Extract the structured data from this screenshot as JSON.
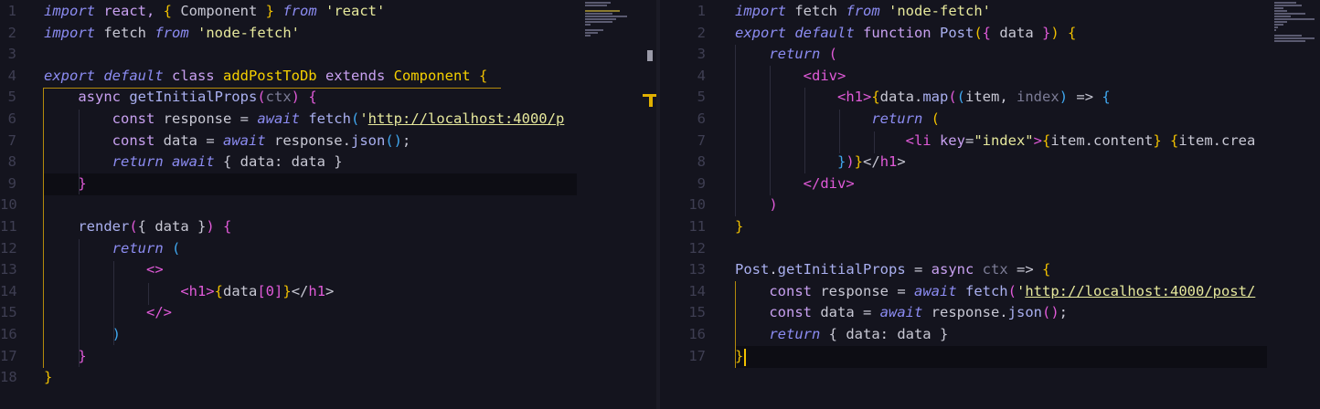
{
  "left_editor": {
    "lines": [
      {
        "n": "1",
        "t": [
          [
            "kw",
            "import"
          ],
          [
            "st",
            " react, "
          ],
          [
            "br1",
            "{"
          ],
          [
            "tx",
            " Component "
          ],
          [
            "br1",
            "}"
          ],
          [
            "kw",
            " from "
          ],
          [
            "str",
            "'react'"
          ]
        ]
      },
      {
        "n": "2",
        "t": [
          [
            "kw",
            "import"
          ],
          [
            "tx",
            " fetch "
          ],
          [
            "kw",
            "from "
          ],
          [
            "str",
            "'node-fetch'"
          ]
        ]
      },
      {
        "n": "3",
        "t": []
      },
      {
        "n": "4",
        "t": [
          [
            "kw",
            "export default "
          ],
          [
            "st",
            "class "
          ],
          [
            "cls",
            "addPostToDb "
          ],
          [
            "st",
            "extends "
          ],
          [
            "cls",
            "Component "
          ],
          [
            "br1",
            "{"
          ]
        ]
      },
      {
        "n": "5",
        "t": [
          [
            "tx",
            "    "
          ],
          [
            "st",
            "async "
          ],
          [
            "fn",
            "getInitialProps"
          ],
          [
            "br2",
            "("
          ],
          [
            "prm",
            "ctx"
          ],
          [
            "br2",
            ")"
          ],
          [
            "tx",
            " "
          ],
          [
            "br2",
            "{"
          ]
        ]
      },
      {
        "n": "6",
        "t": [
          [
            "tx",
            "        "
          ],
          [
            "st",
            "const "
          ],
          [
            "tx",
            "response = "
          ],
          [
            "kw",
            "await "
          ],
          [
            "fn",
            "fetch"
          ],
          [
            "br3",
            "("
          ],
          [
            "str",
            "'"
          ],
          [
            "url",
            "http://localhost:4000/p"
          ]
        ]
      },
      {
        "n": "7",
        "t": [
          [
            "tx",
            "        "
          ],
          [
            "st",
            "const "
          ],
          [
            "tx",
            "data = "
          ],
          [
            "kw",
            "await "
          ],
          [
            "tx",
            "response."
          ],
          [
            "fn",
            "json"
          ],
          [
            "br3",
            "()"
          ],
          [
            "tx",
            ";"
          ]
        ]
      },
      {
        "n": "8",
        "t": [
          [
            "tx",
            "        "
          ],
          [
            "kw",
            "return "
          ],
          [
            "kw",
            "await"
          ],
          [
            "tx",
            " { data: data }"
          ]
        ]
      },
      {
        "n": "9",
        "t": [
          [
            "tx",
            "    "
          ],
          [
            "br2",
            "}"
          ]
        ]
      },
      {
        "n": "10",
        "t": []
      },
      {
        "n": "11",
        "t": [
          [
            "tx",
            "    "
          ],
          [
            "fn",
            "render"
          ],
          [
            "br2",
            "("
          ],
          [
            "tx",
            "{ data }"
          ],
          [
            "br2",
            ")"
          ],
          [
            "tx",
            " "
          ],
          [
            "br2",
            "{"
          ]
        ]
      },
      {
        "n": "12",
        "t": [
          [
            "tx",
            "        "
          ],
          [
            "kw",
            "return "
          ],
          [
            "br3",
            "("
          ]
        ]
      },
      {
        "n": "13",
        "t": [
          [
            "tx",
            "            "
          ],
          [
            "tag",
            "<>"
          ]
        ]
      },
      {
        "n": "14",
        "t": [
          [
            "tx",
            "                "
          ],
          [
            "tag",
            "<h1>"
          ],
          [
            "br1",
            "{"
          ],
          [
            "tx",
            "data"
          ],
          [
            "br2",
            "["
          ],
          [
            "num",
            "0"
          ],
          [
            "br2",
            "]"
          ],
          [
            "br1",
            "}"
          ],
          [
            "tx",
            "</"
          ],
          [
            "tag",
            "h1"
          ],
          [
            "tx",
            ">"
          ]
        ]
      },
      {
        "n": "15",
        "t": [
          [
            "tx",
            "            "
          ],
          [
            "tag",
            "</>"
          ]
        ]
      },
      {
        "n": "16",
        "t": [
          [
            "tx",
            "        "
          ],
          [
            "br3",
            ")"
          ]
        ]
      },
      {
        "n": "17",
        "t": [
          [
            "tx",
            "    "
          ],
          [
            "br2",
            "}"
          ]
        ]
      },
      {
        "n": "18",
        "t": [
          [
            "br1",
            "}"
          ]
        ]
      }
    ]
  },
  "right_editor": {
    "lines": [
      {
        "n": "1",
        "t": [
          [
            "kw",
            "import"
          ],
          [
            "tx",
            " fetch "
          ],
          [
            "kw",
            "from "
          ],
          [
            "str",
            "'node-fetch'"
          ]
        ]
      },
      {
        "n": "2",
        "t": [
          [
            "kw",
            "export default "
          ],
          [
            "st",
            "function "
          ],
          [
            "fn",
            "Post"
          ],
          [
            "br1",
            "("
          ],
          [
            "br2",
            "{"
          ],
          [
            "tx",
            " data "
          ],
          [
            "br2",
            "}"
          ],
          [
            "br1",
            ")"
          ],
          [
            "tx",
            " "
          ],
          [
            "br1",
            "{"
          ]
        ]
      },
      {
        "n": "3",
        "t": [
          [
            "tx",
            "    "
          ],
          [
            "kw",
            "return "
          ],
          [
            "br2",
            "("
          ]
        ]
      },
      {
        "n": "4",
        "t": [
          [
            "tx",
            "        "
          ],
          [
            "tag",
            "<div>"
          ]
        ]
      },
      {
        "n": "5",
        "t": [
          [
            "tx",
            "            "
          ],
          [
            "tag",
            "<h1>"
          ],
          [
            "br1",
            "{"
          ],
          [
            "tx",
            "data."
          ],
          [
            "fn",
            "map"
          ],
          [
            "br2",
            "("
          ],
          [
            "br3",
            "("
          ],
          [
            "tx",
            "item, "
          ],
          [
            "prm",
            "index"
          ],
          [
            "br3",
            ")"
          ],
          [
            "tx",
            " => "
          ],
          [
            "br3",
            "{"
          ]
        ]
      },
      {
        "n": "6",
        "t": [
          [
            "tx",
            "                "
          ],
          [
            "kw",
            "return "
          ],
          [
            "br1",
            "("
          ]
        ]
      },
      {
        "n": "7",
        "t": [
          [
            "tx",
            "                    "
          ],
          [
            "tag",
            "<li "
          ],
          [
            "st",
            "key"
          ],
          [
            "tx",
            "="
          ],
          [
            "str",
            "\"index\""
          ],
          [
            "tag",
            ">"
          ],
          [
            "br1",
            "{"
          ],
          [
            "tx",
            "item.content"
          ],
          [
            "br1",
            "}"
          ],
          [
            "tx",
            " "
          ],
          [
            "br1",
            "{"
          ],
          [
            "tx",
            "item.crea"
          ]
        ]
      },
      {
        "n": "8",
        "t": [
          [
            "tx",
            "            "
          ],
          [
            "br3",
            "}"
          ],
          [
            "br2",
            ")"
          ],
          [
            "br1",
            "}"
          ],
          [
            "tx",
            "</"
          ],
          [
            "tag",
            "h1"
          ],
          [
            "tx",
            ">"
          ]
        ]
      },
      {
        "n": "9",
        "t": [
          [
            "tx",
            "        "
          ],
          [
            "tag",
            "</div>"
          ]
        ]
      },
      {
        "n": "10",
        "t": [
          [
            "tx",
            "    "
          ],
          [
            "br2",
            ")"
          ]
        ]
      },
      {
        "n": "11",
        "t": [
          [
            "br1",
            "}"
          ]
        ]
      },
      {
        "n": "12",
        "t": []
      },
      {
        "n": "13",
        "t": [
          [
            "fn",
            "Post"
          ],
          [
            "tx",
            "."
          ],
          [
            "fn",
            "getInitialProps"
          ],
          [
            "tx",
            " = "
          ],
          [
            "st",
            "async "
          ],
          [
            "prm",
            "ctx"
          ],
          [
            "tx",
            " => "
          ],
          [
            "br1",
            "{"
          ]
        ]
      },
      {
        "n": "14",
        "t": [
          [
            "tx",
            "    "
          ],
          [
            "st",
            "const "
          ],
          [
            "tx",
            "response = "
          ],
          [
            "kw",
            "await "
          ],
          [
            "fn",
            "fetch"
          ],
          [
            "br2",
            "("
          ],
          [
            "str",
            "'"
          ],
          [
            "url",
            "http://localhost:4000/post/"
          ]
        ]
      },
      {
        "n": "15",
        "t": [
          [
            "tx",
            "    "
          ],
          [
            "st",
            "const "
          ],
          [
            "tx",
            "data = "
          ],
          [
            "kw",
            "await "
          ],
          [
            "tx",
            "response."
          ],
          [
            "fn",
            "json"
          ],
          [
            "br2",
            "()"
          ],
          [
            "tx",
            ";"
          ]
        ]
      },
      {
        "n": "16",
        "t": [
          [
            "tx",
            "    "
          ],
          [
            "kw",
            "return"
          ],
          [
            "tx",
            " { data: data }"
          ]
        ]
      },
      {
        "n": "17",
        "t": [
          [
            "br1",
            "}"
          ]
        ]
      }
    ]
  },
  "colors": {
    "background": "#14141e",
    "keyword": "#8c8cf2",
    "string": "#e6e89c",
    "class": "#f5d000",
    "tag": "#e05ad8",
    "bracket_blue": "#40a8f0"
  },
  "icons": {
    "scrollbar_marker": "scroll-marker-icon",
    "overview_ruler_marker": "ruler-marker-icon"
  }
}
